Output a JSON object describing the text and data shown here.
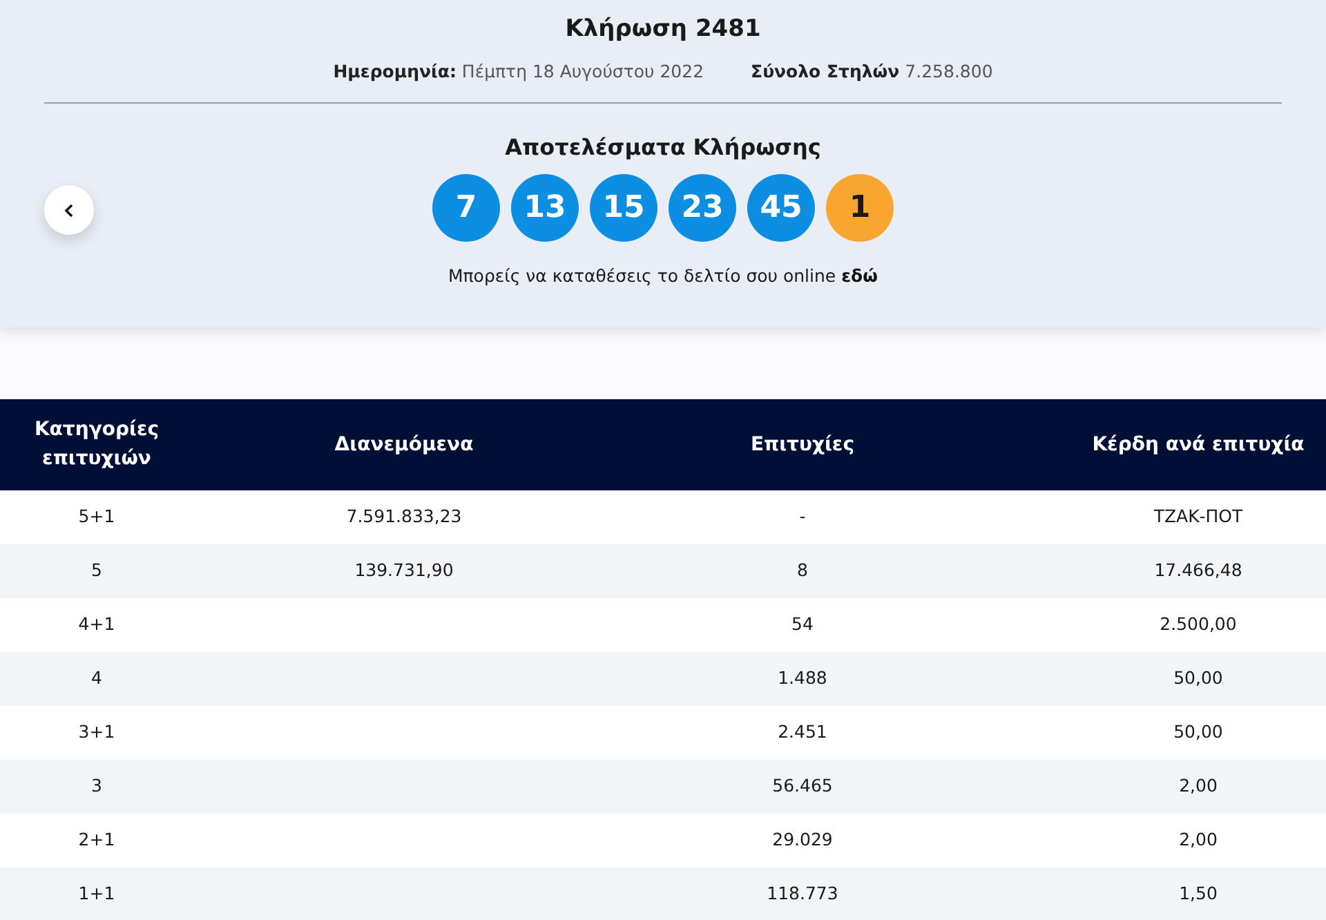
{
  "draw": {
    "title": "Κλήρωση 2481",
    "date_label": "Ημερομηνία:",
    "date": "Πέμπτη 18 Αυγούστου 2022",
    "columns_label": "Σύνολο Στηλών",
    "columns": "7.258.800"
  },
  "results": {
    "title": "Αποτελέσματα Κλήρωσης",
    "balls": [
      {
        "number": "7",
        "kind": "main"
      },
      {
        "number": "13",
        "kind": "main"
      },
      {
        "number": "15",
        "kind": "main"
      },
      {
        "number": "23",
        "kind": "main"
      },
      {
        "number": "45",
        "kind": "main"
      },
      {
        "number": "1",
        "kind": "bonus"
      }
    ],
    "note": "Μπορείς να καταθέσεις το δελτίο σου online",
    "link": "εδώ"
  },
  "table": {
    "columns": [
      "Κατηγορίες επιτυχιών",
      "Διανεμόμενα",
      "Επιτυχίες",
      "Κέρδη ανά επιτυχία"
    ],
    "rows": [
      [
        "5+1",
        "7.591.833,23",
        "-",
        "ΤΖΑΚ-ΠΟΤ"
      ],
      [
        "5",
        "139.731,90",
        "8",
        "17.466,48"
      ],
      [
        "4+1",
        "",
        "54",
        "2.500,00"
      ],
      [
        "4",
        "",
        "1.488",
        "50,00"
      ],
      [
        "3+1",
        "",
        "2.451",
        "50,00"
      ],
      [
        "3",
        "",
        "56.465",
        "2,00"
      ],
      [
        "2+1",
        "",
        "29.029",
        "2,00"
      ],
      [
        "1+1",
        "",
        "118.773",
        "1,50"
      ]
    ]
  }
}
